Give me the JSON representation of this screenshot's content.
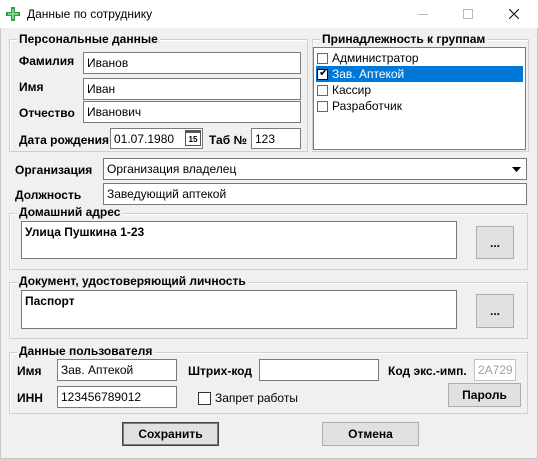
{
  "window": {
    "title": "Данные по сотруднику"
  },
  "personal": {
    "legend": "Персональные данные",
    "lastname_label": "Фамилия",
    "lastname_value": "Иванов",
    "firstname_label": "Имя",
    "firstname_value": "Иван",
    "patronymic_label": "Отчество",
    "patronymic_value": "Иванович",
    "birthdate_label": "Дата рождения",
    "birthdate_value": "01.07.1980",
    "calendar_glyph": "15",
    "tab_label": "Таб №",
    "tab_value": "123"
  },
  "groups": {
    "legend": "Принадлежность к группам",
    "items": [
      {
        "label": "Администратор",
        "checked": false,
        "selected": false
      },
      {
        "label": "Зав. Аптекой",
        "checked": true,
        "selected": true
      },
      {
        "label": "Кассир",
        "checked": false,
        "selected": false
      },
      {
        "label": "Разработчик",
        "checked": false,
        "selected": false
      }
    ]
  },
  "organization": {
    "label": "Организация",
    "value": "Организация владелец"
  },
  "position": {
    "label": "Должность",
    "value": "Заведующий аптекой"
  },
  "address": {
    "legend": "Домашний адрес",
    "value": "Улица Пушкина 1-23",
    "button_label": "..."
  },
  "document": {
    "legend": "Документ, удостоверяющий личность",
    "value": "Паспорт",
    "button_label": "..."
  },
  "user": {
    "legend": "Данные пользователя",
    "name_label": "Имя",
    "name_value": "Зав. Аптекой",
    "barcode_label": "Штрих-код",
    "barcode_value": "",
    "code_label": "Код экс.-имп.",
    "code_value": "2A729",
    "inn_label": "ИНН",
    "inn_value": "123456789012",
    "block_label": "Запрет работы",
    "password_button": "Пароль"
  },
  "footer": {
    "save_label": "Сохранить",
    "cancel_label": "Отмена"
  },
  "colors": {
    "selection": "#0078d7",
    "app_icon": "#2ea043"
  },
  "icons": {
    "app": "pharmacy-cross-icon",
    "minimize": "minimize-icon",
    "maximize": "maximize-icon",
    "close": "close-icon",
    "dropdown": "chevron-down-icon"
  }
}
